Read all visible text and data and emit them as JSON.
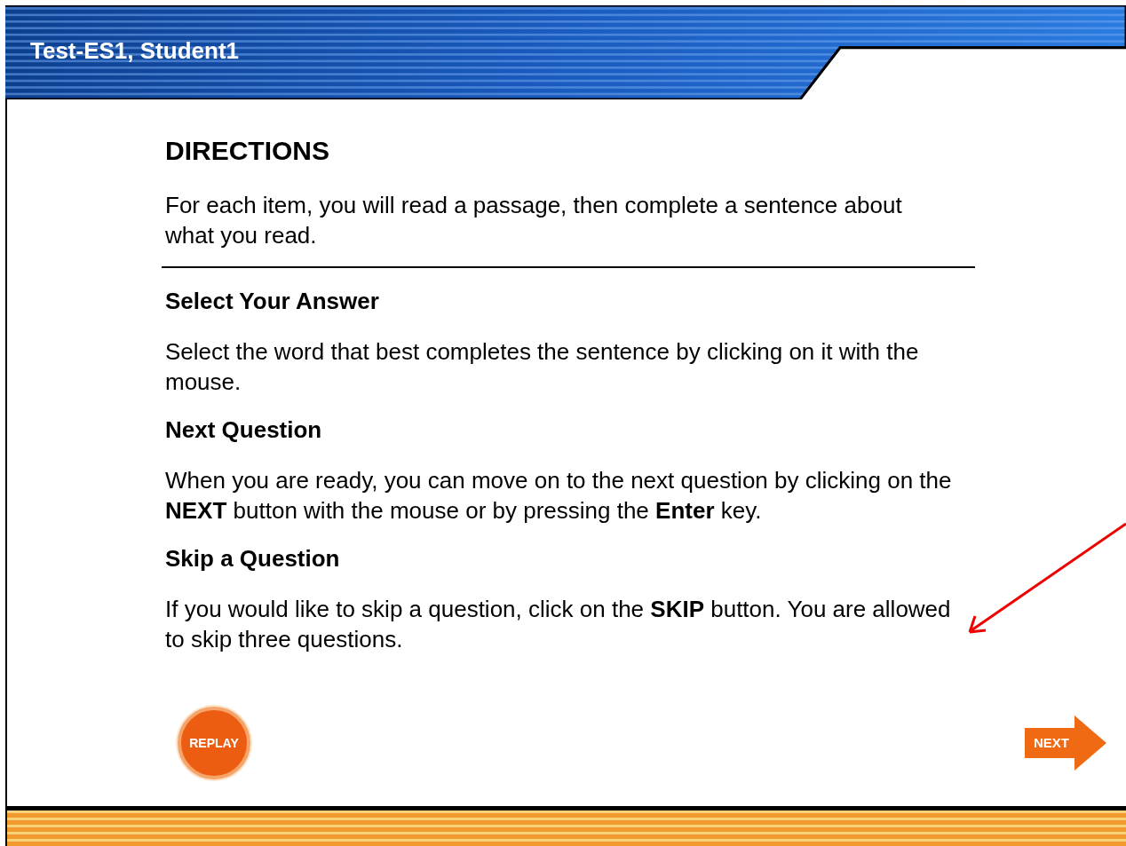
{
  "header": {
    "title": "Test-ES1, Student1"
  },
  "directions": {
    "heading": "DIRECTIONS",
    "text": "For each item, you will read a passage, then complete a sentence about what you read."
  },
  "sections": [
    {
      "heading": "Select Your Answer",
      "text": "Select the word that best completes the sentence by clicking on it with the mouse."
    },
    {
      "heading": "Next Question",
      "text": "When you are ready, you can move on to the next question by clicking on the **NEXT** button with the mouse or by pressing the **Enter** key."
    },
    {
      "heading": "Skip a Question",
      "text": "If you would like to skip a question, click on the **SKIP** button. You are allowed to skip three questions."
    }
  ],
  "buttons": {
    "replay": "REPLAY",
    "next": "NEXT"
  }
}
